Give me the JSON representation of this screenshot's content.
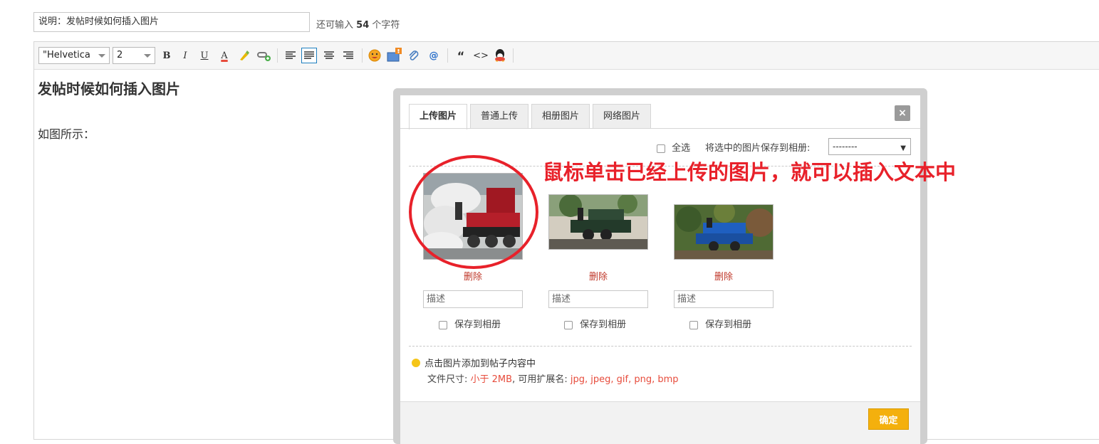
{
  "description": {
    "value": "说明：发帖时候如何插入图片",
    "remain_prefix": "还可输入",
    "remain_count": "54",
    "remain_suffix": "个字符"
  },
  "toolbar": {
    "font_family": "\"Helvetica",
    "font_size": "2",
    "bold": "B",
    "italic": "I",
    "underline": "U",
    "font_color": "A",
    "quote": "“",
    "code": "<>"
  },
  "content": {
    "title": "发帖时候如何插入图片",
    "line": "如图所示："
  },
  "dialog": {
    "tabs": [
      "上传图片",
      "普通上传",
      "相册图片",
      "网络图片"
    ],
    "close": "×",
    "select_all": "全选",
    "save_selected": "将选中的图片保存到相册:",
    "album_value": "--------",
    "images": [
      {
        "delete": "删除",
        "desc_placeholder": "描述",
        "save_label": "保存到相册"
      },
      {
        "delete": "删除",
        "desc_placeholder": "描述",
        "save_label": "保存到相册"
      },
      {
        "delete": "删除",
        "desc_placeholder": "描述",
        "save_label": "保存到相册"
      }
    ],
    "tip": "点击图片添加到帖子内容中",
    "size_prefix": "文件尺寸:",
    "size_value": "小于 2MB",
    "ext_prefix": ", 可用扩展名:",
    "ext_value": "jpg, jpeg, gif, png, bmp",
    "ok": "确定"
  },
  "annotation": "鼠标单击已经上传的图片，就可以插入文本中"
}
